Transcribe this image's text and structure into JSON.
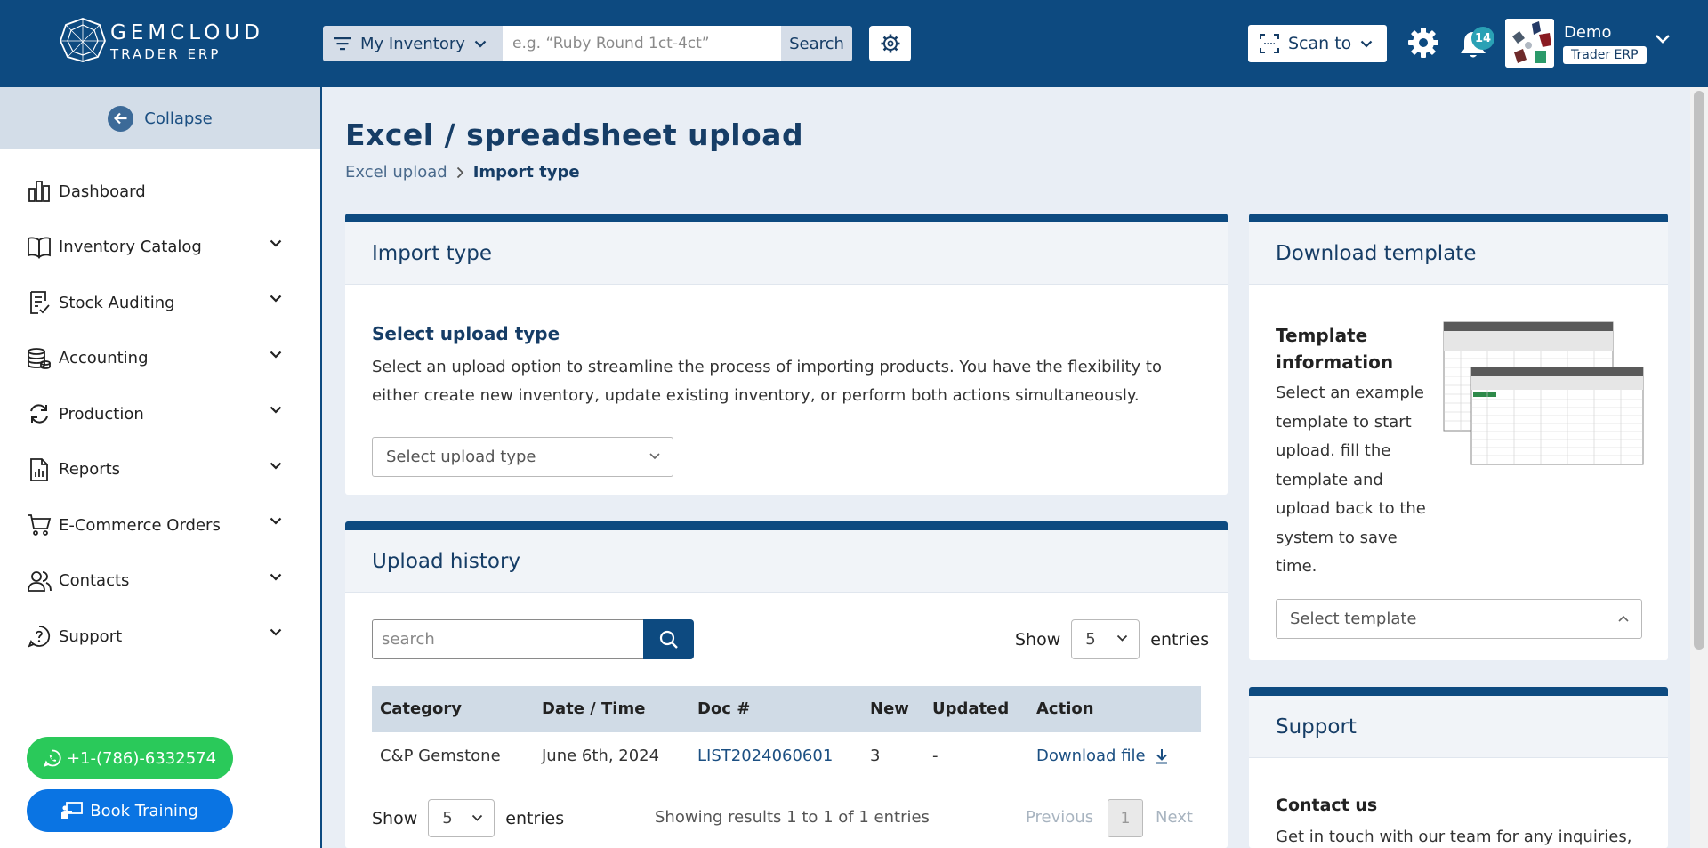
{
  "header": {
    "logo_line1": "GEMCLOUD",
    "logo_line2": "TRADER ERP",
    "inventory_select": "My Inventory",
    "search_placeholder": "e.g. “Ruby Round 1ct-4ct”",
    "search_label": "Search",
    "scan_label": "Scan to",
    "notification_count": "14",
    "user_name": "Demo",
    "user_role": "Trader ERP"
  },
  "sidebar": {
    "collapse_label": "Collapse",
    "items": [
      {
        "label": "Dashboard",
        "icon": "dashboard-icon",
        "has_children": false
      },
      {
        "label": "Inventory Catalog",
        "icon": "book-icon",
        "has_children": true
      },
      {
        "label": "Stock Auditing",
        "icon": "audit-icon",
        "has_children": true
      },
      {
        "label": "Accounting",
        "icon": "coins-icon",
        "has_children": true
      },
      {
        "label": "Production",
        "icon": "refresh-icon",
        "has_children": true
      },
      {
        "label": "Reports",
        "icon": "report-icon",
        "has_children": true
      },
      {
        "label": "E-Commerce Orders",
        "icon": "cart-icon",
        "has_children": true
      },
      {
        "label": "Contacts",
        "icon": "contacts-icon",
        "has_children": true
      },
      {
        "label": "Support",
        "icon": "support-icon",
        "has_children": true
      }
    ],
    "phone_label": "+1-(786)-6332574",
    "training_label": "Book Training"
  },
  "main": {
    "title": "Excel / spreadsheet upload",
    "breadcrumb": [
      "Excel upload",
      "Import type"
    ],
    "import_card": {
      "title": "Import type",
      "subtitle": "Select upload type",
      "description": "Select an upload option to streamline the process of importing products. You have the flexibility to either create new inventory, update existing inventory, or perform both actions simultaneously.",
      "select_placeholder": "Select upload type"
    },
    "history_card": {
      "title": "Upload history",
      "search_placeholder": "search",
      "show_label": "Show",
      "entries_label": "entries",
      "page_size": "5",
      "columns": [
        "Category",
        "Date / Time",
        "Doc #",
        "New",
        "Updated",
        "Action"
      ],
      "rows": [
        {
          "category": "C&P Gemstone",
          "date": "June 6th, 2024",
          "doc": "LIST2024060601",
          "new": "3",
          "updated": "-",
          "action": "Download file"
        }
      ],
      "results_text": "Showing results 1 to 1 of 1 entries",
      "previous_label": "Previous",
      "current_page": "1",
      "next_label": "Next"
    },
    "template_card": {
      "title": "Download template",
      "info_title": "Template information",
      "info_desc": "Select an example template to start upload. fill the template and upload back to the system to save time.",
      "select_placeholder": "Select template"
    },
    "support_card": {
      "title": "Support",
      "contact_title": "Contact us",
      "contact_desc": "Get in touch with our team for any inquiries,"
    }
  },
  "colors": {
    "primary": "#0d4a80",
    "accent_green": "#2ac95a",
    "accent_blue": "#0a74e3",
    "badge": "#2aa1b5"
  }
}
